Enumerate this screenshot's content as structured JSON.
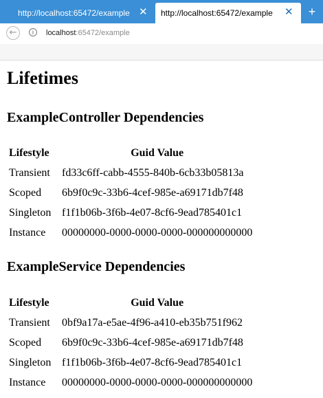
{
  "browser": {
    "tabs": [
      {
        "title": "http://localhost:65472/example",
        "active": false
      },
      {
        "title": "http://localhost:65472/example",
        "active": true
      }
    ],
    "address": {
      "host": "localhost",
      "rest": ":65472/example"
    }
  },
  "page": {
    "title": "Lifetimes",
    "sections": [
      {
        "heading": "ExampleController Dependencies",
        "columns": [
          "Lifestyle",
          "Guid Value"
        ],
        "rows": [
          {
            "lifestyle": "Transient",
            "guid": "fd33c6ff-cabb-4555-840b-6cb33b05813a"
          },
          {
            "lifestyle": "Scoped",
            "guid": "6b9f0c9c-33b6-4cef-985e-a69171db7f48"
          },
          {
            "lifestyle": "Singleton",
            "guid": "f1f1b06b-3f6b-4e07-8cf6-9ead785401c1"
          },
          {
            "lifestyle": "Instance",
            "guid": "00000000-0000-0000-0000-000000000000"
          }
        ]
      },
      {
        "heading": "ExampleService Dependencies",
        "columns": [
          "Lifestyle",
          "Guid Value"
        ],
        "rows": [
          {
            "lifestyle": "Transient",
            "guid": "0bf9a17a-e5ae-4f96-a410-eb35b751f962"
          },
          {
            "lifestyle": "Scoped",
            "guid": "6b9f0c9c-33b6-4cef-985e-a69171db7f48"
          },
          {
            "lifestyle": "Singleton",
            "guid": "f1f1b06b-3f6b-4e07-8cf6-9ead785401c1"
          },
          {
            "lifestyle": "Instance",
            "guid": "00000000-0000-0000-0000-000000000000"
          }
        ]
      }
    ]
  }
}
